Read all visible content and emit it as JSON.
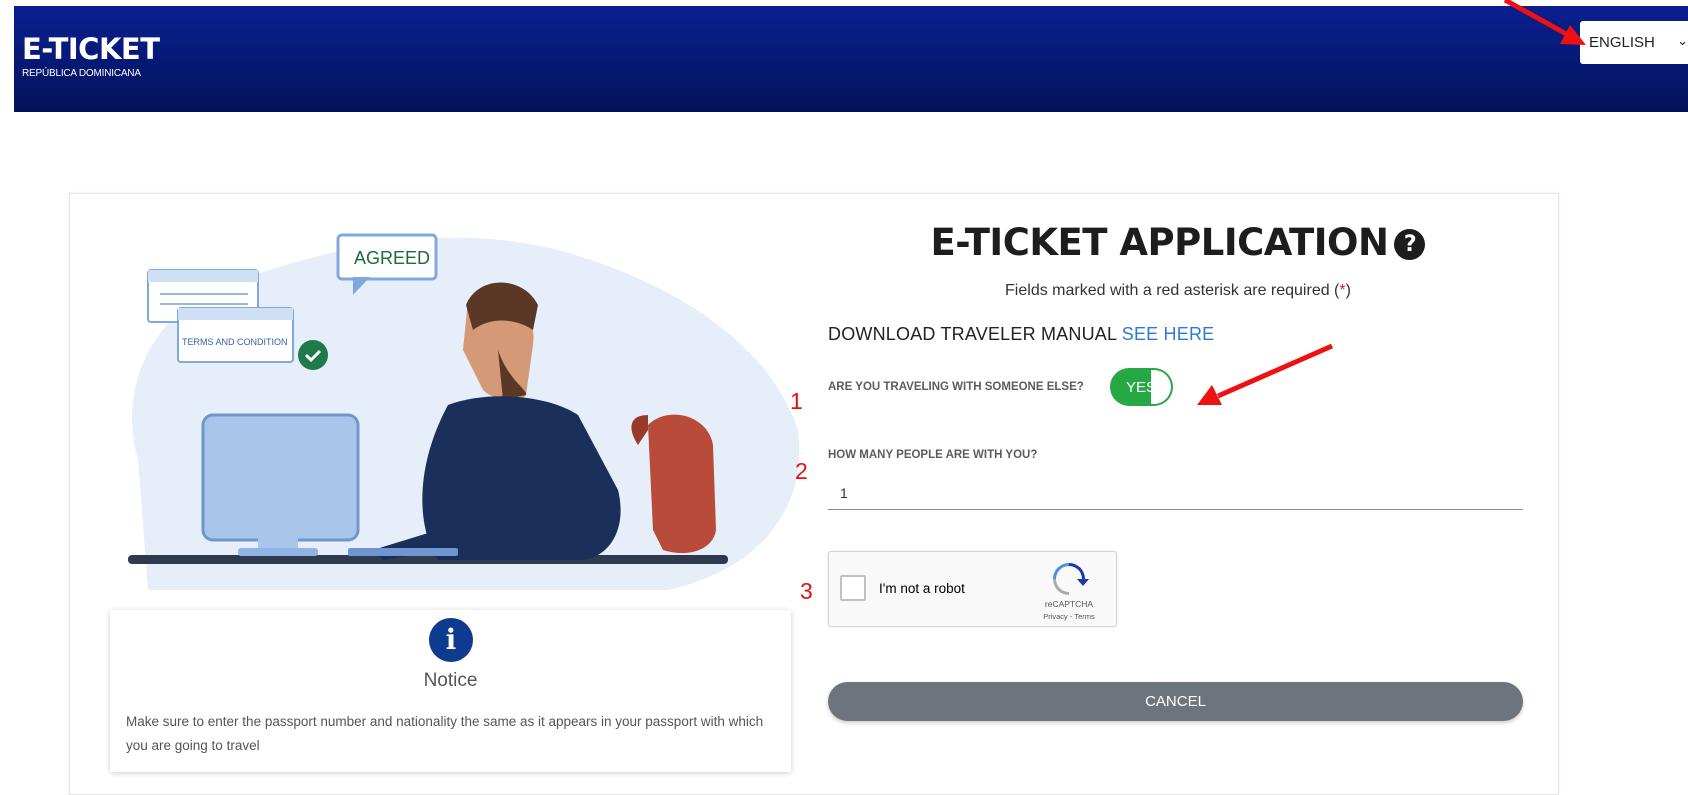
{
  "header": {
    "logo_title": "E-TICKET",
    "logo_subtitle": "REPÚBLICA DOMINICANA",
    "language_selected": "ENGLISH"
  },
  "illustration": {
    "bubble_text": "AGREED",
    "card_text": "TERMS AND CONDITION"
  },
  "notice": {
    "icon": "info-icon",
    "title": "Notice",
    "body": "Make sure to enter the passport number and nationality the same as it appears in your passport with which you are going to travel"
  },
  "form": {
    "title": "E-TICKET APPLICATION",
    "help_icon": "question-circle-icon",
    "required_prefix": "Fields marked with a red asterisk are required (",
    "required_asterisk": "*",
    "required_suffix": ")",
    "download_label": "DOWNLOAD TRAVELER MANUAL",
    "download_link": "SEE HERE",
    "traveling_question": "ARE YOU TRAVELING WITH SOMEONE ELSE?",
    "traveling_toggle": "YES",
    "people_question": "HOW MANY PEOPLE ARE WITH YOU?",
    "people_value": "1",
    "captcha_label": "I'm not a robot",
    "captcha_brand": "reCAPTCHA",
    "captcha_links": "Privacy - Terms",
    "cancel_label": "CANCEL"
  },
  "annotations": {
    "step_1": "1",
    "step_2": "2",
    "step_3": "3",
    "color": "#e21212"
  }
}
